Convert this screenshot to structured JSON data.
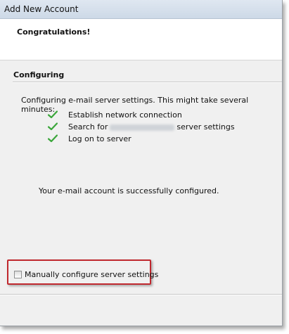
{
  "window": {
    "title": "Add New Account"
  },
  "header": {
    "heading": "Congratulations!"
  },
  "configuring": {
    "title": "Configuring",
    "description": "Configuring e-mail server settings. This might take several minutes:",
    "steps": [
      {
        "text": "Establish network connection",
        "status": "done",
        "icon": "check-icon"
      },
      {
        "text_before": "Search for",
        "text_after": "server settings",
        "redacted": true,
        "status": "done",
        "icon": "check-icon"
      },
      {
        "text": "Log on to server",
        "status": "done",
        "icon": "check-icon"
      }
    ],
    "result": "Your e-mail account is successfully configured."
  },
  "options": {
    "manual_config_label": "Manually configure server settings",
    "manual_config_checked": false
  },
  "colors": {
    "check": "#3aa63a",
    "highlight": "#c0282e",
    "panel": "#f0f0f0"
  }
}
